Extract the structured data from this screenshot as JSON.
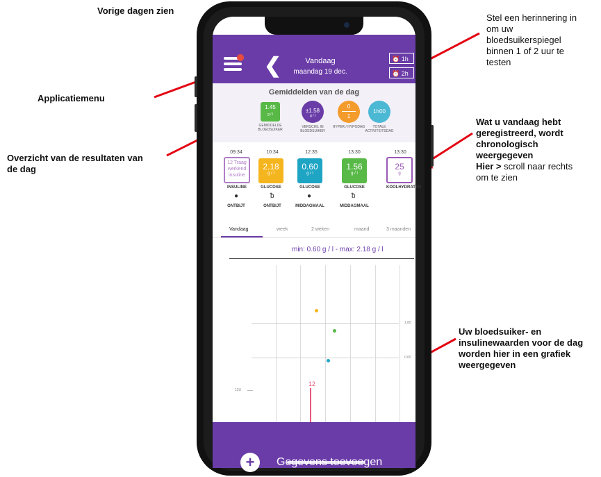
{
  "callouts": {
    "previous_days": "Vorige dagen zien",
    "reminder": [
      "Stel een herinnering in",
      "om uw",
      "bloedsuikerspiegel",
      "binnen 1 of 2 uur te",
      "testen"
    ],
    "app_menu": "Applicatiemenu",
    "overview": [
      "Overzicht van de resultaten van",
      "de dag"
    ],
    "registered": [
      "Wat u vandaag hebt",
      "geregistreerd, wordt",
      "chronologisch",
      "weergegeven"
    ],
    "scroll_prefix": "Hier >",
    "scroll_rest": " scroll naar rechts",
    "scroll_line2": "om te zien",
    "graph": [
      "Uw bloedsuiker- en",
      "insulinewaarden voor de dag",
      "worden hier in een grafiek",
      "weergegeven"
    ]
  },
  "header": {
    "title": "Vandaag",
    "date": "maandag 19 dec.",
    "reminder_1h": "1h",
    "reminder_2h": "2h",
    "color": "#6a3ca8"
  },
  "summary": {
    "title": "Gemiddelden van de dag",
    "items": [
      {
        "value": "1.45",
        "unit": "g / l",
        "label": "GEMIDDELDE BLOEDSUIKER",
        "color": "#58b947"
      },
      {
        "value": "±1.58",
        "unit": "g / l",
        "label": "VERSCHIL IN BLOEDSUIKER",
        "color": "#6a3ca8"
      },
      {
        "value_top": "0",
        "value_bottom": "1",
        "label": "HYPER / HYPODAG",
        "color": "#f39c2c"
      },
      {
        "value": "1h00",
        "label": "TOTALE ACTIVITEITSDAG",
        "color": "#4bb8d4"
      }
    ]
  },
  "entries": [
    {
      "time": "09:34",
      "value": "12 Traag werkend insuline",
      "type": "INSULINE",
      "meal": "ONTBIJT",
      "color": "#b07cc8"
    },
    {
      "time": "10:34",
      "value": "2.18",
      "unit": "g / l",
      "type": "GLUCOSE",
      "meal": "ONTBIJT",
      "color": "#f5b51e"
    },
    {
      "time": "12:35",
      "value": "0.60",
      "unit": "g / l",
      "type": "GLUCOSE",
      "meal": "MIDDAGMAAL",
      "color": "#1ea5c4"
    },
    {
      "time": "13:30",
      "value": "1.56",
      "unit": "g / l",
      "type": "GLUCOSE",
      "meal": "MIDDAGMAAL",
      "color": "#58b947"
    },
    {
      "time": "13:30",
      "value": "25",
      "unit": "g",
      "type": "KOOLHYDRATEN",
      "color": "#9b59b6"
    }
  ],
  "tabs": [
    "Vandaag",
    "week",
    "2 weken",
    "maand",
    "3 maanden"
  ],
  "range_text": "min: 0.60 g / l - max: 2.18 g / l",
  "graph": {
    "y_label_high": "1.80",
    "y_label_low": "0.60",
    "insulin_axis_label": "12U",
    "insulin_value": "12",
    "points": [
      {
        "value": 2.18,
        "color": "#f5b51e"
      },
      {
        "value": 1.56,
        "color": "#58b947"
      },
      {
        "value": 0.6,
        "color": "#1ea5c4"
      }
    ]
  },
  "bottom": {
    "add_label": "Gegevens toevoegen"
  }
}
